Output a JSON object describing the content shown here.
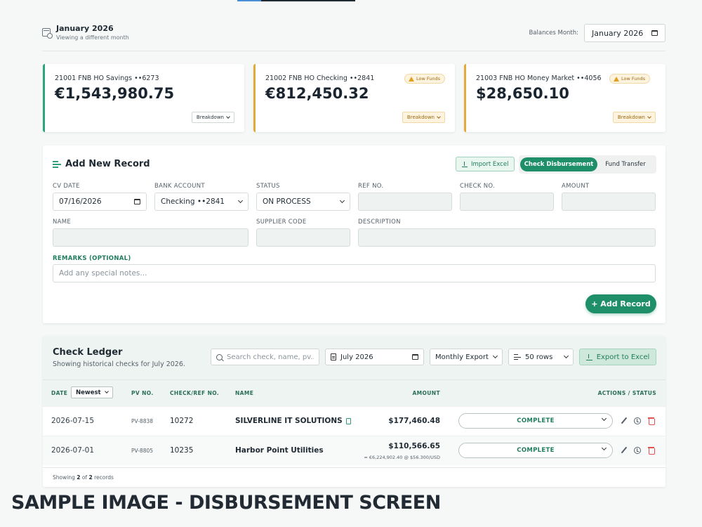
{
  "header": {
    "month_title": "January 2026",
    "month_sub": "Viewing a different month",
    "balances_label": "Balances Month:",
    "balances_value": "January 2026"
  },
  "cards": [
    {
      "name": "21001 FNB HO Savings ••6273",
      "amount": "€1,543,980.75",
      "badge": "",
      "breakdown": "Breakdown",
      "accent": "#2ea47a"
    },
    {
      "name": "21002 FNB HO Checking ••2841",
      "amount": "€812,450.32",
      "badge": "Low Funds",
      "breakdown": "Breakdown",
      "accent": "#e2a93b"
    },
    {
      "name": "21003 FNB HO Money Market ••4056",
      "amount": "$28,650.10",
      "badge": "Low Funds",
      "breakdown": "Breakdown",
      "accent": "#e2a93b"
    }
  ],
  "form": {
    "title": "Add New Record",
    "import_label": "Import Excel",
    "tabs": {
      "active": "Check Disbursement",
      "other": "Fund Transfer"
    },
    "labels": {
      "cv_date": "CV DATE",
      "bank_account": "BANK ACCOUNT",
      "status": "STATUS",
      "ref_no": "REF NO.",
      "check_no": "CHECK NO.",
      "amount": "AMOUNT",
      "name": "NAME",
      "supplier_code": "SUPPLIER CODE",
      "description": "DESCRIPTION",
      "remarks": "REMARKS (OPTIONAL)"
    },
    "values": {
      "cv_date": "07/16/2026",
      "bank_account": "Checking ••2841",
      "status": "ON PROCESS"
    },
    "remarks_placeholder": "Add any special notes...",
    "add_button": "+ Add Record"
  },
  "ledger": {
    "title": "Check Ledger",
    "subtitle": "Showing historical checks for July 2026.",
    "search_placeholder": "Search check, name, pv...",
    "month": "July 2026",
    "export_mode": "Monthly Export",
    "rows_per_page": "50 rows",
    "export_button": "Export to Excel",
    "columns": {
      "date": "DATE",
      "sort": "Newest",
      "pv": "PV NO.",
      "ref": "CHECK/REF NO.",
      "name": "NAME",
      "amount": "AMOUNT",
      "actions": "ACTIONS / STATUS"
    },
    "rows": [
      {
        "date": "2026-07-15",
        "pv": "PV-8838",
        "ref": "10272",
        "name": "SILVERLINE IT SOLUTIONS",
        "amount": "$177,460.48",
        "fx": "",
        "status": "COMPLETE"
      },
      {
        "date": "2026-07-01",
        "pv": "PV-8805",
        "ref": "10235",
        "name": "Harbor Point Utilities",
        "amount": "$110,566.65",
        "fx": "≈ €6,224,902.40 @ $56.300/USD",
        "status": "COMPLETE"
      }
    ],
    "footer": {
      "prefix": "Showing",
      "shown": "2",
      "of": "of",
      "total": "2",
      "suffix": "records"
    }
  },
  "caption": "SAMPLE IMAGE - DISBURSEMENT SCREEN",
  "colors": {
    "accent_green": "#1f8f69",
    "warn": "#e2a93b",
    "danger": "#e0524f"
  }
}
